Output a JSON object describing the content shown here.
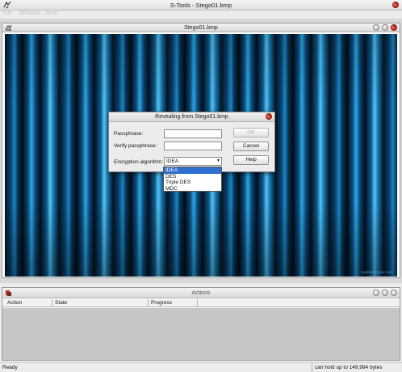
{
  "app": {
    "title": "S-Tools - Stego01.bmp"
  },
  "menu": {
    "items": [
      "File",
      "Window",
      "Help"
    ]
  },
  "image_window": {
    "title": "Stego01.bmp",
    "watermark": "top4Wallpaper.com"
  },
  "dialog": {
    "title": "Revealing from Stego01.bmp",
    "passphrase_label": "Passphrase:",
    "verify_label": "Verify passphrase:",
    "algorithm_label": "Encryption algorithm:",
    "selected_algorithm": "IDEA",
    "options": [
      "IDEA",
      "DES",
      "Triple DES",
      "MDC"
    ],
    "ok_label": "OK",
    "cancel_label": "Cancel",
    "help_label": "Help"
  },
  "actions": {
    "title": "Actions",
    "columns": [
      "Action",
      "State",
      "Progress"
    ]
  },
  "status": {
    "left": "Ready",
    "right": "can hold up to 149,984 bytes"
  },
  "colors": {
    "accent": "#2f6fd0",
    "close": "#d8332a"
  }
}
